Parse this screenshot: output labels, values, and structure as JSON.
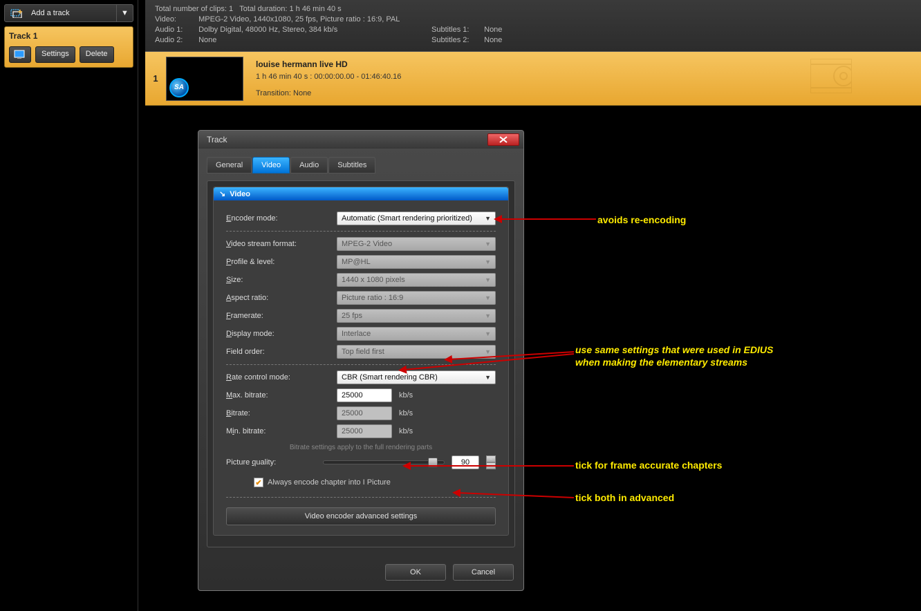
{
  "sidebar": {
    "add_track": "Add a track",
    "track_title": "Track 1",
    "settings_btn": "Settings",
    "delete_btn": "Delete"
  },
  "info": {
    "total_clips_label": "Total number of clips:",
    "total_clips": "1",
    "total_duration_label": "Total duration:",
    "total_duration": "1 h 46 min 40 s",
    "video_label": "Video:",
    "video_val": "MPEG-2 Video,  1440x1080,  25  fps,  Picture ratio : 16:9,  PAL",
    "audio1_label": "Audio 1:",
    "audio1_val": "Dolby Digital,  48000  Hz,  Stereo,  384  kb/s",
    "audio2_label": "Audio 2:",
    "audio2_val": "None",
    "sub1_label": "Subtitles 1:",
    "sub1_val": "None",
    "sub2_label": "Subtitles 2:",
    "sub2_val": "None"
  },
  "clip": {
    "index": "1",
    "title": "louise hermann live HD",
    "duration": "1 h 46 min 40 s :  00:00:00.00 - 01:46:40.16",
    "transition": "Transition: None"
  },
  "dialog": {
    "title": "Track",
    "tabs": {
      "general": "General",
      "video": "Video",
      "audio": "Audio",
      "subs": "Subtitles"
    },
    "panel_head": "Video",
    "labels": {
      "enc_mode": "Encoder mode:",
      "stream_fmt": "Video stream format:",
      "profile": "Profile & level:",
      "size": "Size:",
      "aspect": "Aspect ratio:",
      "framerate": "Framerate:",
      "display": "Display mode:",
      "field": "Field order:",
      "rate_ctrl": "Rate control mode:",
      "max_bitrate": "Max. bitrate:",
      "bitrate": "Bitrate:",
      "min_bitrate": "Min. bitrate:",
      "quality": "Picture quality:",
      "unit": "kb/s",
      "note": "Bitrate settings apply to the full rendering parts",
      "chapter_ip": "Always encode chapter into I Picture",
      "advanced": "Video encoder advanced settings"
    },
    "values": {
      "enc_mode": "Automatic (Smart rendering prioritized)",
      "stream_fmt": "MPEG-2 Video",
      "profile": "MP@HL",
      "size": "1440 x 1080 pixels",
      "aspect": "Picture ratio : 16:9",
      "framerate": "25  fps",
      "display": "Interlace",
      "field": "Top field first",
      "rate_ctrl": "CBR (Smart rendering CBR)",
      "max_bitrate": "25000",
      "bitrate": "25000",
      "min_bitrate": "25000",
      "quality": "90"
    },
    "ok": "OK",
    "cancel": "Cancel"
  },
  "annotations": {
    "a1": "avoids re-encoding",
    "a2a": "use same settings that were used in EDIUS",
    "a2b": "when making the elementary streams",
    "a3": "tick for frame accurate chapters",
    "a4": "tick both in advanced"
  }
}
